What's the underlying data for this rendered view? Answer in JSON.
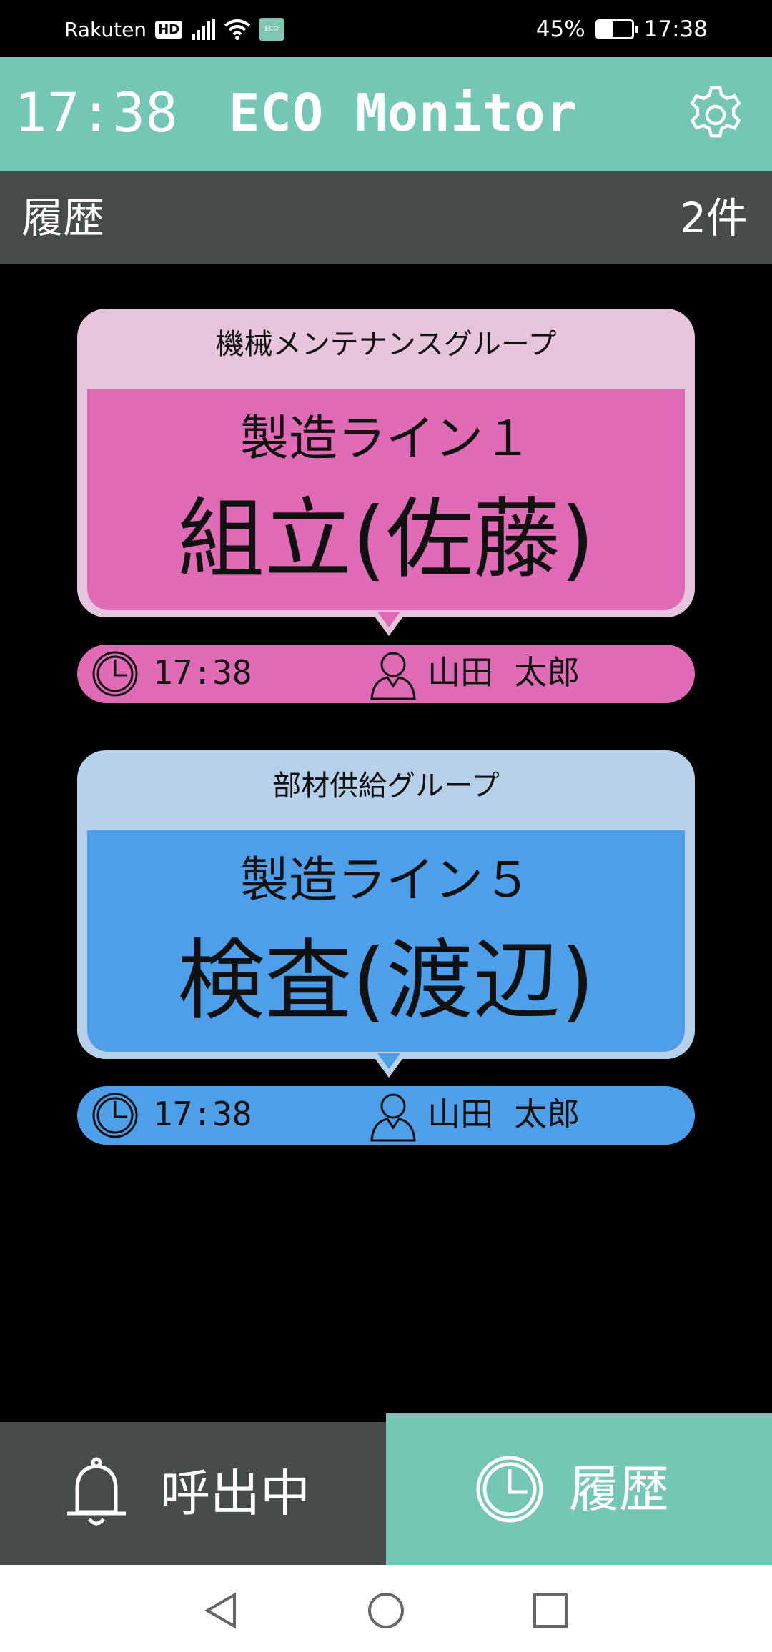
{
  "status_bar": {
    "carrier": "Rakuten",
    "carrier_badge": "HD",
    "app_badge": "ECO",
    "battery_percent": "45%",
    "battery_level": 0.45,
    "time": "17:38"
  },
  "header": {
    "time": "17:38",
    "title": "ECO Monitor",
    "settings_icon": "gear-icon"
  },
  "sub_header": {
    "title": "履歴",
    "count": "2件"
  },
  "cards": [
    {
      "group": "機械メンテナンスグループ",
      "line": "製造ライン１",
      "worker": "組立(佐藤)",
      "time": "17:38",
      "user": "山田  太郎",
      "colors": {
        "outer": "#e6c4dc",
        "inner": "#e06ab5"
      }
    },
    {
      "group": "部材供給グループ",
      "line": "製造ライン５",
      "worker": "検査(渡辺)",
      "time": "17:38",
      "user": "山田  太郎",
      "colors": {
        "outer": "#b8d1ea",
        "inner": "#4e9fe9"
      }
    }
  ],
  "tabs": [
    {
      "label": "呼出中",
      "icon": "bell-icon",
      "selected": false
    },
    {
      "label": "履歴",
      "icon": "clock-icon",
      "selected": true
    }
  ],
  "colors": {
    "accent": "#74c6b5",
    "dark_bar": "#464b4b",
    "background": "#000000"
  },
  "nav_bar": {
    "buttons": [
      "back-icon",
      "home-icon",
      "recents-icon"
    ]
  }
}
